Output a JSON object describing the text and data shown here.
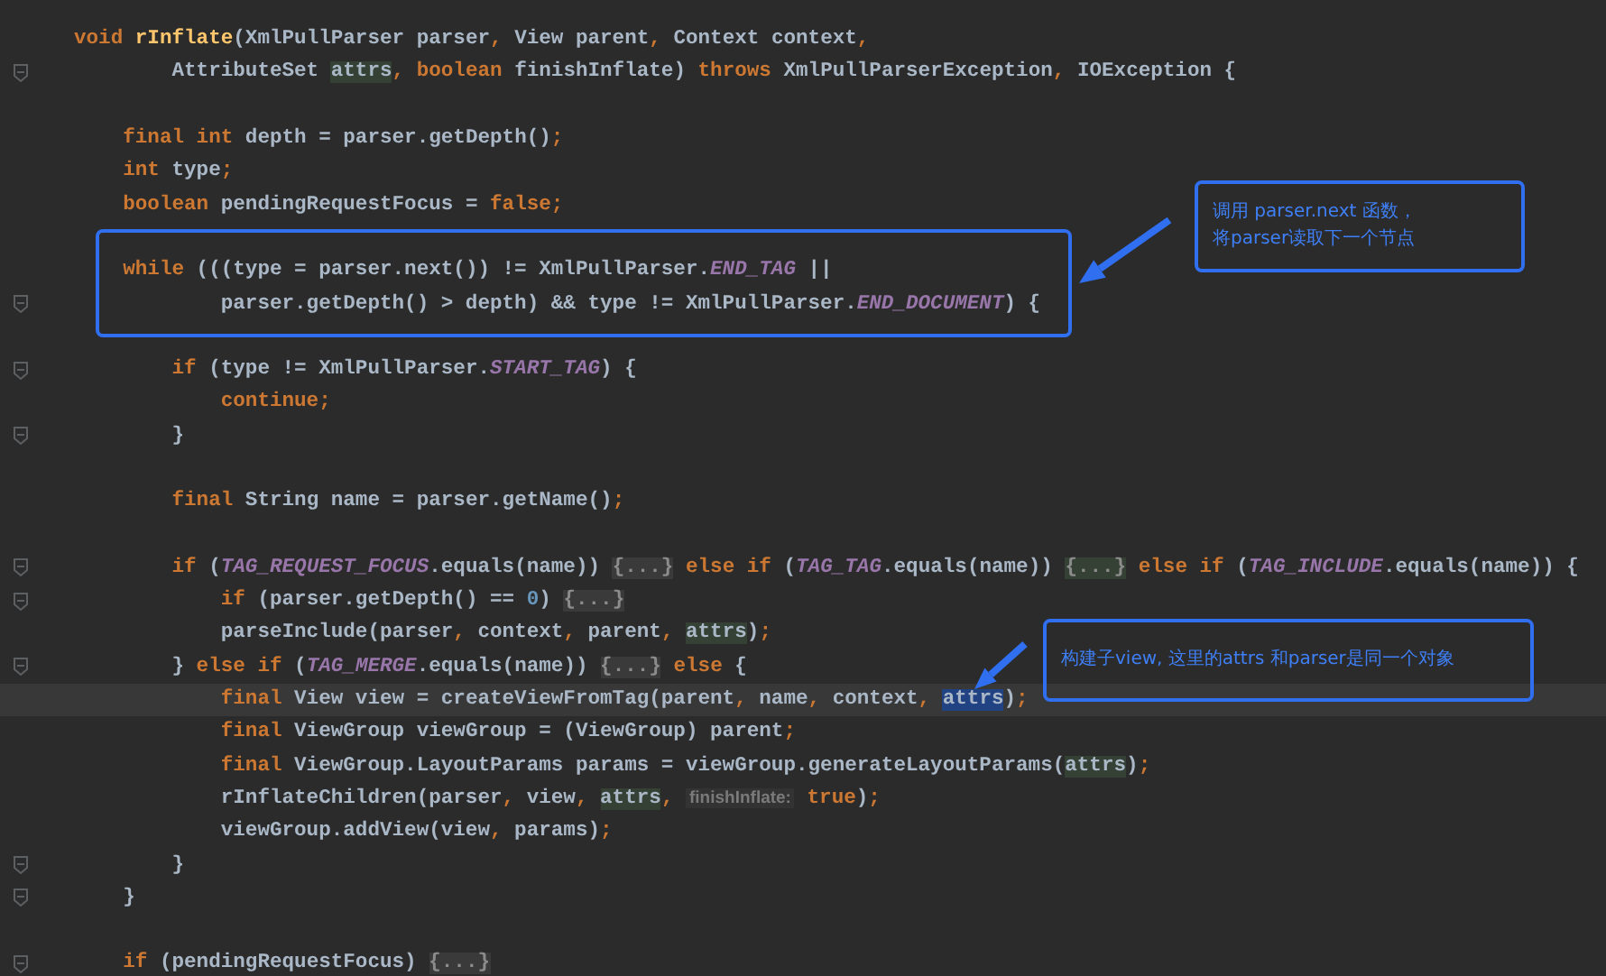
{
  "editor": {
    "lines": [
      {
        "fold_marker": false,
        "current": false,
        "tokens": [
          {
            "kind": "kw",
            "text": "void"
          },
          {
            "kind": "fn",
            "text": " rInflate"
          },
          {
            "kind": "plain",
            "text": "(XmlPullParser parser"
          },
          {
            "kind": "punct",
            "text": ","
          },
          {
            "kind": "plain",
            "text": " View parent"
          },
          {
            "kind": "punct",
            "text": ","
          },
          {
            "kind": "plain",
            "text": " Context context"
          },
          {
            "kind": "punct",
            "text": ","
          }
        ]
      },
      {
        "fold_marker": true,
        "current": false,
        "tokens": [
          {
            "kind": "plain",
            "text": "        AttributeSet "
          },
          {
            "kind": "param",
            "text": "attrs"
          },
          {
            "kind": "punct",
            "text": ","
          },
          {
            "kind": "kw",
            "text": " boolean"
          },
          {
            "kind": "plain",
            "text": " finishInflate) "
          },
          {
            "kind": "kw",
            "text": "throws"
          },
          {
            "kind": "plain",
            "text": " XmlPullParserException"
          },
          {
            "kind": "punct",
            "text": ","
          },
          {
            "kind": "plain",
            "text": " IOException {"
          }
        ]
      },
      {
        "fold_marker": false,
        "current": false
      },
      {
        "fold_marker": false,
        "current": false,
        "tokens": [
          {
            "kind": "kw",
            "text": "    final int"
          },
          {
            "kind": "plain",
            "text": " depth = parser.getDepth()"
          },
          {
            "kind": "punct",
            "text": ";"
          }
        ]
      },
      {
        "fold_marker": false,
        "current": false,
        "tokens": [
          {
            "kind": "kw",
            "text": "    int"
          },
          {
            "kind": "plain",
            "text": " type"
          },
          {
            "kind": "punct",
            "text": ";"
          }
        ]
      },
      {
        "fold_marker": false,
        "current": false,
        "tokens": [
          {
            "kind": "kw",
            "text": "    boolean"
          },
          {
            "kind": "plain",
            "text": " pendingRequestFocus = "
          },
          {
            "kind": "kw",
            "text": "false"
          },
          {
            "kind": "punct",
            "text": ";"
          }
        ]
      },
      {
        "fold_marker": false,
        "current": false
      },
      {
        "fold_marker": false,
        "current": false,
        "tokens": [
          {
            "kind": "kw",
            "text": "    while"
          },
          {
            "kind": "plain",
            "text": " (((type = parser.next()) != XmlPullParser."
          },
          {
            "kind": "const",
            "text": "END_TAG"
          },
          {
            "kind": "plain",
            "text": " ||"
          }
        ]
      },
      {
        "fold_marker": true,
        "current": false,
        "tokens": [
          {
            "kind": "plain",
            "text": "            parser.getDepth() > depth) && type != XmlPullParser."
          },
          {
            "kind": "const",
            "text": "END_DOCUMENT"
          },
          {
            "kind": "plain",
            "text": ") {"
          }
        ]
      },
      {
        "fold_marker": false,
        "current": false
      },
      {
        "fold_marker": true,
        "current": false,
        "tokens": [
          {
            "kind": "kw",
            "text": "        if"
          },
          {
            "kind": "plain",
            "text": " (type != XmlPullParser."
          },
          {
            "kind": "const",
            "text": "START_TAG"
          },
          {
            "kind": "plain",
            "text": ") {"
          }
        ]
      },
      {
        "fold_marker": false,
        "current": false,
        "tokens": [
          {
            "kind": "kw",
            "text": "            continue"
          },
          {
            "kind": "punct",
            "text": ";"
          }
        ]
      },
      {
        "fold_marker": true,
        "current": false,
        "tokens": [
          {
            "kind": "plain",
            "text": "        }"
          }
        ]
      },
      {
        "fold_marker": false,
        "current": false
      },
      {
        "fold_marker": false,
        "current": false,
        "tokens": [
          {
            "kind": "kw",
            "text": "        final"
          },
          {
            "kind": "plain",
            "text": " String name = parser.getName()"
          },
          {
            "kind": "punct",
            "text": ";"
          }
        ]
      },
      {
        "fold_marker": false,
        "current": false
      },
      {
        "fold_marker": true,
        "current": false,
        "tokens": [
          {
            "kind": "kw",
            "text": "        if"
          },
          {
            "kind": "plain",
            "text": " ("
          },
          {
            "kind": "const",
            "text": "TAG_REQUEST_FOCUS"
          },
          {
            "kind": "plain",
            "text": ".equals(name)) "
          },
          {
            "kind": "fold",
            "text": "{...}"
          },
          {
            "kind": "kw",
            "text": " else if"
          },
          {
            "kind": "plain",
            "text": " ("
          },
          {
            "kind": "const",
            "text": "TAG_TAG"
          },
          {
            "kind": "plain",
            "text": ".equals(name)) "
          },
          {
            "kind": "fold_match",
            "text": "{...}"
          },
          {
            "kind": "kw",
            "text": " else if"
          },
          {
            "kind": "plain",
            "text": " ("
          },
          {
            "kind": "const",
            "text": "TAG_INCLUDE"
          },
          {
            "kind": "plain",
            "text": ".equals(name)) {"
          }
        ]
      },
      {
        "fold_marker": true,
        "current": false,
        "tokens": [
          {
            "kind": "kw",
            "text": "            if"
          },
          {
            "kind": "plain",
            "text": " (parser.getDepth() == "
          },
          {
            "kind": "num",
            "text": "0"
          },
          {
            "kind": "plain",
            "text": ") "
          },
          {
            "kind": "fold",
            "text": "{...}"
          }
        ]
      },
      {
        "fold_marker": false,
        "current": false,
        "tokens": [
          {
            "kind": "plain",
            "text": "            parseInclude(parser"
          },
          {
            "kind": "punct",
            "text": ","
          },
          {
            "kind": "plain",
            "text": " context"
          },
          {
            "kind": "punct",
            "text": ","
          },
          {
            "kind": "plain",
            "text": " parent"
          },
          {
            "kind": "punct",
            "text": ", "
          },
          {
            "kind": "param",
            "text": "attrs"
          },
          {
            "kind": "plain",
            "text": ")"
          },
          {
            "kind": "punct",
            "text": ";"
          }
        ]
      },
      {
        "fold_marker": true,
        "current": false,
        "tokens": [
          {
            "kind": "plain",
            "text": "        } "
          },
          {
            "kind": "kw",
            "text": "else if"
          },
          {
            "kind": "plain",
            "text": " ("
          },
          {
            "kind": "const",
            "text": "TAG_MERGE"
          },
          {
            "kind": "plain",
            "text": ".equals(name)) "
          },
          {
            "kind": "fold",
            "text": "{...}"
          },
          {
            "kind": "kw",
            "text": " else"
          },
          {
            "kind": "plain",
            "text": " {"
          }
        ]
      },
      {
        "fold_marker": false,
        "current": true,
        "tokens": [
          {
            "kind": "kw",
            "text": "            final"
          },
          {
            "kind": "plain",
            "text": " View view = createViewFromTag(parent"
          },
          {
            "kind": "punct",
            "text": ","
          },
          {
            "kind": "plain",
            "text": " name"
          },
          {
            "kind": "punct",
            "text": ","
          },
          {
            "kind": "plain",
            "text": " context"
          },
          {
            "kind": "punct",
            "text": ", "
          },
          {
            "kind": "selected",
            "text": "attrs"
          },
          {
            "kind": "plain",
            "text": ")"
          },
          {
            "kind": "punct",
            "text": ";"
          }
        ]
      },
      {
        "fold_marker": false,
        "current": false,
        "tokens": [
          {
            "kind": "kw",
            "text": "            final"
          },
          {
            "kind": "plain",
            "text": " ViewGroup viewGroup = (ViewGroup) parent"
          },
          {
            "kind": "punct",
            "text": ";"
          }
        ]
      },
      {
        "fold_marker": false,
        "current": false,
        "tokens": [
          {
            "kind": "kw",
            "text": "            final"
          },
          {
            "kind": "plain",
            "text": " ViewGroup.LayoutParams params = viewGroup.generateLayoutParams("
          },
          {
            "kind": "param",
            "text": "attrs"
          },
          {
            "kind": "plain",
            "text": ")"
          },
          {
            "kind": "punct",
            "text": ";"
          }
        ]
      },
      {
        "fold_marker": false,
        "current": false,
        "tokens": [
          {
            "kind": "plain",
            "text": "            rInflateChildren(parser"
          },
          {
            "kind": "punct",
            "text": ","
          },
          {
            "kind": "plain",
            "text": " view"
          },
          {
            "kind": "punct",
            "text": ", "
          },
          {
            "kind": "param",
            "text": "attrs"
          },
          {
            "kind": "punct",
            "text": ", "
          },
          {
            "kind": "hint",
            "text": "finishInflate:"
          },
          {
            "kind": "kw",
            "text": " true"
          },
          {
            "kind": "plain",
            "text": ")"
          },
          {
            "kind": "punct",
            "text": ";"
          }
        ]
      },
      {
        "fold_marker": false,
        "current": false,
        "tokens": [
          {
            "kind": "plain",
            "text": "            viewGroup.addView(view"
          },
          {
            "kind": "punct",
            "text": ","
          },
          {
            "kind": "plain",
            "text": " params)"
          },
          {
            "kind": "punct",
            "text": ";"
          }
        ]
      },
      {
        "fold_marker": true,
        "current": false,
        "tokens": [
          {
            "kind": "plain",
            "text": "        }"
          }
        ]
      },
      {
        "fold_marker": true,
        "current": false,
        "tokens": [
          {
            "kind": "plain",
            "text": "    }"
          }
        ]
      },
      {
        "fold_marker": false,
        "current": false
      },
      {
        "fold_marker": true,
        "current": false,
        "tokens": [
          {
            "kind": "kw",
            "text": "    if"
          },
          {
            "kind": "plain",
            "text": " (pendingRequestFocus) "
          },
          {
            "kind": "fold",
            "text": "{...}"
          }
        ]
      }
    ]
  },
  "annotations": [
    {
      "lines": [
        "调用 parser.next 函数，",
        "将parser读取下一个节点"
      ]
    },
    {
      "lines": [
        "构建子view, 这里的attrs 和parser是同一个对象"
      ]
    }
  ]
}
